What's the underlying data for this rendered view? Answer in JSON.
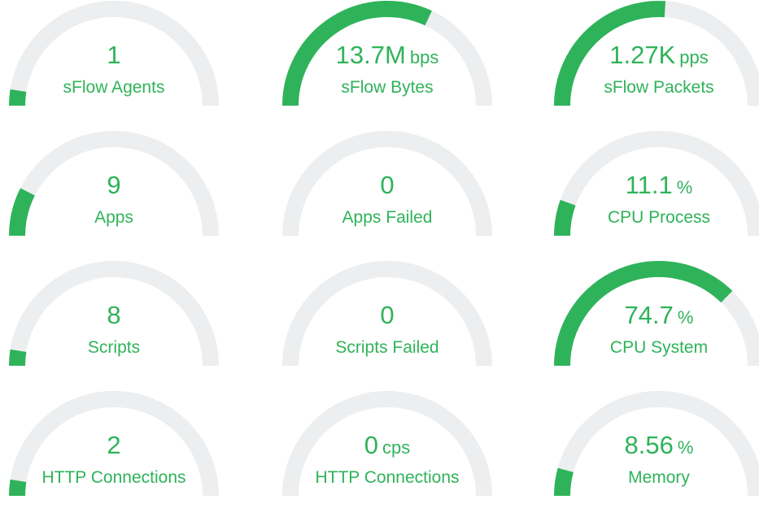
{
  "theme": {
    "accent": "#2fb35a",
    "track": "#eceeef"
  },
  "gauges": [
    {
      "value": "1",
      "unit": "",
      "label": "sFlow Agents",
      "fill": 0.05
    },
    {
      "value": "13.7M",
      "unit": "bps",
      "label": "sFlow Bytes",
      "fill": 0.64
    },
    {
      "value": "1.27K",
      "unit": "pps",
      "label": "sFlow Packets",
      "fill": 0.52
    },
    {
      "value": "9",
      "unit": "",
      "label": "Apps",
      "fill": 0.15
    },
    {
      "value": "0",
      "unit": "",
      "label": "Apps Failed",
      "fill": 0
    },
    {
      "value": "11.1",
      "unit": "%",
      "label": "CPU Process",
      "fill": 0.111
    },
    {
      "value": "8",
      "unit": "",
      "label": "Scripts",
      "fill": 0.05
    },
    {
      "value": "0",
      "unit": "",
      "label": "Scripts Failed",
      "fill": 0
    },
    {
      "value": "74.7",
      "unit": "%",
      "label": "CPU System",
      "fill": 0.747
    },
    {
      "value": "2",
      "unit": "",
      "label": "HTTP Connections",
      "fill": 0.05
    },
    {
      "value": "0",
      "unit": "cps",
      "label": "HTTP Connections",
      "fill": 0
    },
    {
      "value": "8.56",
      "unit": "%",
      "label": "Memory",
      "fill": 0.0856
    }
  ]
}
